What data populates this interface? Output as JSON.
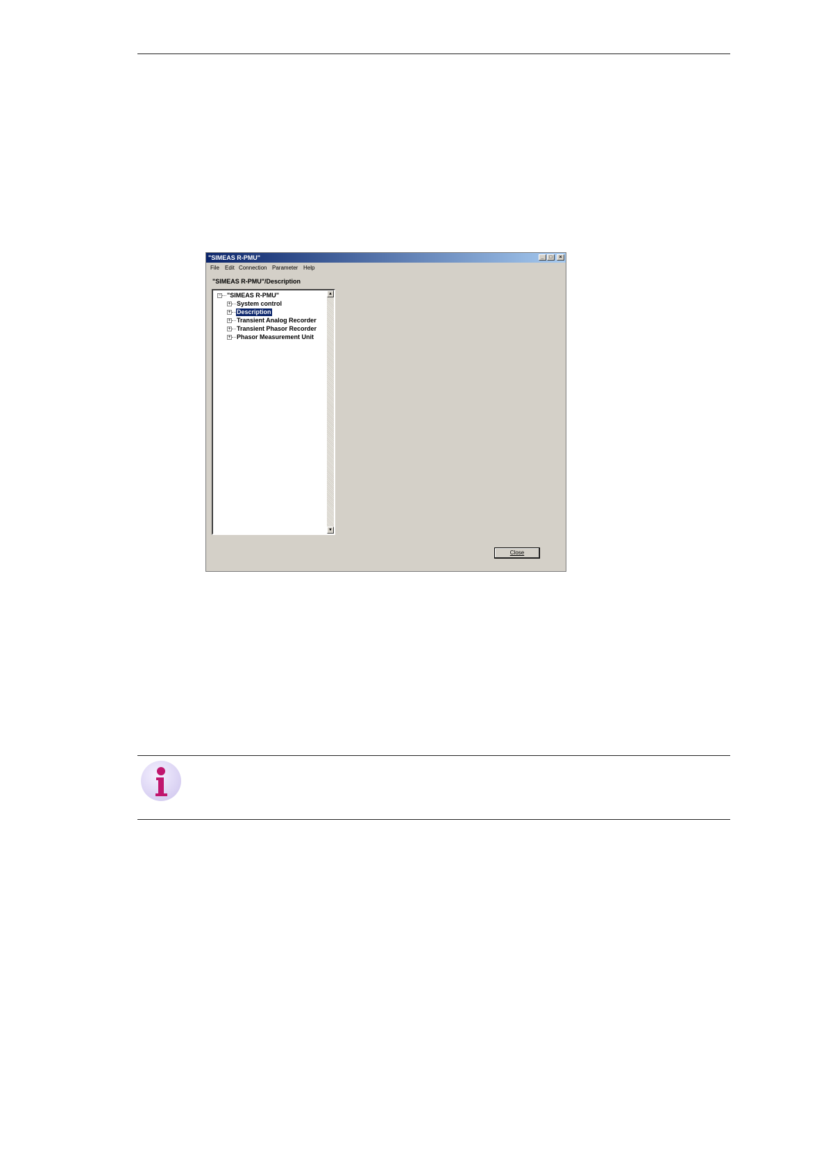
{
  "window": {
    "title": "\"SIMEAS R-PMU\"",
    "controls": {
      "minimize": "_",
      "maximize": "□",
      "close": "×"
    },
    "menu": [
      "File",
      "Edit",
      "Connection",
      "Parameter",
      "Help"
    ],
    "path_label": "\"SIMEAS R-PMU\"/Description",
    "tree": {
      "root": {
        "label": "\"SIMEAS R-PMU\"",
        "expander": "−"
      },
      "children": [
        {
          "label": "System control",
          "expander": "+",
          "selected": false
        },
        {
          "label": "Description",
          "expander": "+",
          "selected": true
        },
        {
          "label": "Transient Analog Recorder",
          "expander": "+",
          "selected": false
        },
        {
          "label": "Transient Phasor Recorder",
          "expander": "+",
          "selected": false
        },
        {
          "label": "Phasor Measurement Unit",
          "expander": "+",
          "selected": false
        }
      ],
      "scroll_up": "▲",
      "scroll_down": "▼"
    },
    "close_button": "Close",
    "colors": {
      "titlebar": "#0a246a",
      "face": "#d4d0c8",
      "selection": "#0a246a"
    }
  },
  "note": {
    "icon": "info-icon",
    "icon_color": "#c0166e"
  }
}
